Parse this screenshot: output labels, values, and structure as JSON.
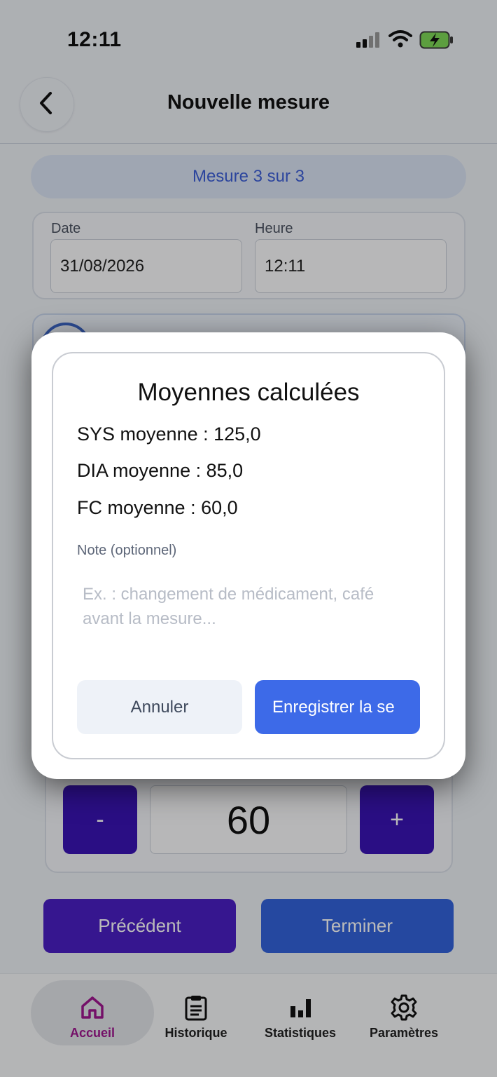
{
  "status_bar": {
    "time": "12:11",
    "icons": [
      "signal-icon",
      "wifi-icon",
      "battery-charging-icon"
    ]
  },
  "header": {
    "title": "Nouvelle mesure",
    "back_icon": "chevron-left-icon"
  },
  "progress": {
    "label": "Mesure 3 sur 3"
  },
  "datetime": {
    "date_label": "Date",
    "date_value": "31/08/2026",
    "time_label": "Heure",
    "time_value": "12:11"
  },
  "stepper": {
    "minus_label": "-",
    "value": "60",
    "plus_label": "+"
  },
  "actions": {
    "previous_label": "Précédent",
    "finish_label": "Terminer"
  },
  "dialog": {
    "title": "Moyennes calculées",
    "sys_avg": "SYS moyenne : 125,0",
    "dia_avg": "DIA moyenne : 85,0",
    "fc_avg": "FC moyenne : 60,0",
    "note_label": "Note (optionnel)",
    "note_placeholder": "Ex. : changement de médicament, café avant la mesure...",
    "cancel_label": "Annuler",
    "save_label": "Enregistrer la se"
  },
  "tabbar": {
    "active_color": "#a0168f",
    "items": [
      {
        "label": "Accueil",
        "icon": "home-icon",
        "active": true
      },
      {
        "label": "Historique",
        "icon": "clipboard-icon",
        "active": false
      },
      {
        "label": "Statistiques",
        "icon": "bar-chart-icon",
        "active": false
      },
      {
        "label": "Paramètres",
        "icon": "gear-icon",
        "active": false
      }
    ]
  }
}
